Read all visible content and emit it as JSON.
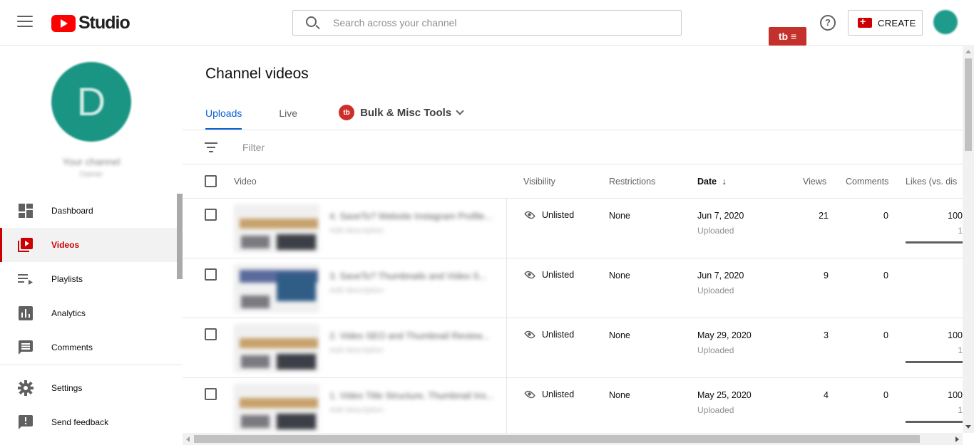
{
  "header": {
    "logo_text": "Studio",
    "search_placeholder": "Search across your channel",
    "tb_badge": "tb ≡",
    "help_glyph": "?",
    "create_label": "CREATE"
  },
  "sidebar": {
    "channel_initial": "D",
    "channel_name": "Your channel",
    "channel_sub": "Owner",
    "items": [
      {
        "label": "Dashboard",
        "icon": "dashboard-icon"
      },
      {
        "label": "Videos",
        "icon": "videos-icon",
        "active": true
      },
      {
        "label": "Playlists",
        "icon": "playlists-icon"
      },
      {
        "label": "Analytics",
        "icon": "analytics-icon"
      },
      {
        "label": "Comments",
        "icon": "comments-icon"
      },
      {
        "label": "Settings",
        "icon": "settings-icon"
      },
      {
        "label": "Send feedback",
        "icon": "feedback-icon"
      }
    ]
  },
  "main": {
    "title": "Channel videos",
    "tabs": [
      {
        "label": "Uploads",
        "active": true
      },
      {
        "label": "Live"
      }
    ],
    "tools_badge": "tb",
    "tools_label": "Bulk & Misc Tools",
    "filter_placeholder": "Filter",
    "columns": {
      "video": "Video",
      "visibility": "Visibility",
      "restrictions": "Restrictions",
      "date": "Date",
      "date_sort_glyph": "↓",
      "views": "Views",
      "comments": "Comments",
      "likes": "Likes (vs. dis"
    },
    "rows": [
      {
        "title": "4. SaveTo? Website Instagram Profile...",
        "desc": "Add description",
        "visibility": "Unlisted",
        "restrictions": "None",
        "date": "Jun 7, 2020",
        "date_status": "Uploaded",
        "views": "21",
        "comments": "0",
        "likes": "100",
        "likes_sub": "1",
        "likes_ratio": 1.0,
        "thumb": "warm"
      },
      {
        "title": "3. SaveTo? Thumbnails and Video S...",
        "desc": "Add description",
        "visibility": "Unlisted",
        "restrictions": "None",
        "date": "Jun 7, 2020",
        "date_status": "Uploaded",
        "views": "9",
        "comments": "0",
        "likes": "",
        "likes_sub": "",
        "likes_ratio": null,
        "thumb": "blue"
      },
      {
        "title": "2. Video SEO and Thumbnail Review...",
        "desc": "Add description",
        "visibility": "Unlisted",
        "restrictions": "None",
        "date": "May 29, 2020",
        "date_status": "Uploaded",
        "views": "3",
        "comments": "0",
        "likes": "100",
        "likes_sub": "1",
        "likes_ratio": 1.0,
        "thumb": "light"
      },
      {
        "title": "1. Video Title Structure, Thumbnail Ins...",
        "desc": "Add description",
        "visibility": "Unlisted",
        "restrictions": "None",
        "date": "May 25, 2020",
        "date_status": "Uploaded",
        "views": "4",
        "comments": "0",
        "likes": "100",
        "likes_sub": "1",
        "likes_ratio": 1.0,
        "thumb": "warm"
      }
    ]
  },
  "colors": {
    "brand_red": "#ff0000",
    "active_red": "#cc0000",
    "tab_blue": "#065fd4",
    "avatar_teal": "#1a9584"
  }
}
